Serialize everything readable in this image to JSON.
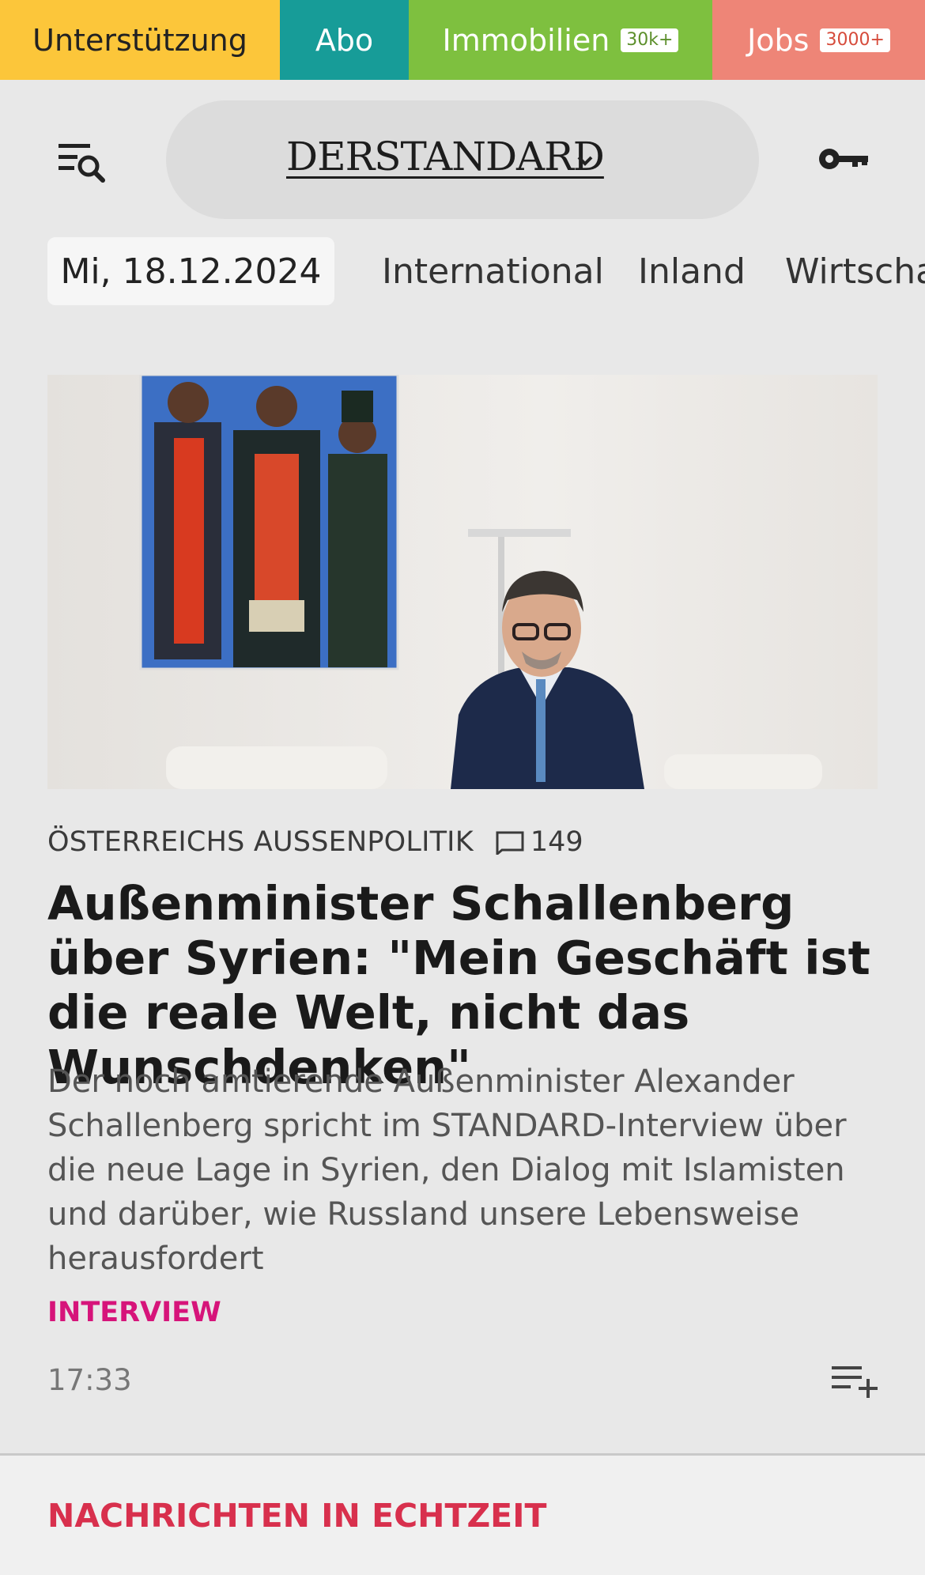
{
  "topbar": {
    "support_label": "Unterstützung",
    "abo_label": "Abo",
    "immo_label": "Immobilien",
    "immo_badge": "30k+",
    "jobs_label": "Jobs",
    "jobs_badge": "3000+"
  },
  "header": {
    "logo": "DERSTANDARD"
  },
  "nav": {
    "date": "Mi, 18.12.2024",
    "items": [
      "International",
      "Inland",
      "Wirtschaft"
    ]
  },
  "article": {
    "kicker": "ÖSTERREICHS AUSSENPOLITIK",
    "comment_count": "149",
    "headline": "Außenminister Schallenberg über Syrien: \"Mein Geschäft ist die reale Welt, nicht das Wunschdenken\"",
    "teaser": "Der noch amtierende Außenminister Alexander Schallenberg spricht im STANDARD-Interview über die neue Lage in Syrien, den Dialog mit Islamisten und darüber, wie Russland unsere Lebensweise herausfordert",
    "tag": "INTERVIEW",
    "time": "17:33"
  },
  "section": {
    "title": "NACHRICHTEN IN ECHTZEIT"
  },
  "colors": {
    "support": "#fcc63a",
    "abo": "#179c98",
    "immo": "#7ec03f",
    "jobs": "#ee8577",
    "tag": "#d6147a",
    "section_title": "#d8304d"
  }
}
